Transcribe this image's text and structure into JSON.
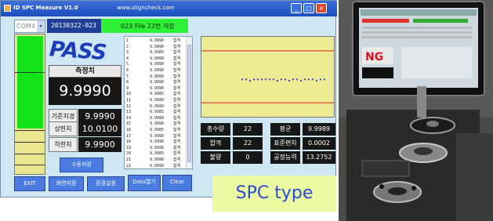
{
  "window": {
    "title": "ID SPC Measure V1.0",
    "url": "www.aligncheck.com",
    "minimize_glyph": "_",
    "maximize_glyph": "□",
    "close_glyph": "×"
  },
  "port": {
    "selected": "COM4",
    "arrow": "▾"
  },
  "date_code": "20130322-023",
  "file_status": "023 File 22번 저장",
  "result": "PASS",
  "measured": {
    "label": "측정치",
    "value": "9.9990"
  },
  "limits": [
    {
      "label": "기준치경",
      "value": "9.9990"
    },
    {
      "label": "상한치",
      "value": "10.0100"
    },
    {
      "label": "하한치",
      "value": "9.9900"
    }
  ],
  "buttons": {
    "manual_save": "수동저장",
    "exit": "EXIT",
    "screen_save": "화면저장",
    "settings": "환경설정",
    "data_open": "Data열기",
    "clear": "Clear"
  },
  "measurement_list": [
    {
      "n": "1",
      "v": "9.9990",
      "r": "합격"
    },
    {
      "n": "2",
      "v": "9.9990",
      "r": "합격"
    },
    {
      "n": "3",
      "v": "9.9985",
      "r": "합격"
    },
    {
      "n": "4",
      "v": "9.9990",
      "r": "합격"
    },
    {
      "n": "5",
      "v": "9.9990",
      "r": "합격"
    },
    {
      "n": "6",
      "v": "9.9990",
      "r": "합격"
    },
    {
      "n": "7",
      "v": "9.9990",
      "r": "합격"
    },
    {
      "n": "8",
      "v": "9.9990",
      "r": "합격"
    },
    {
      "n": "9",
      "v": "9.9990",
      "r": "합격"
    },
    {
      "n": "10",
      "v": "9.9985",
      "r": "합격"
    },
    {
      "n": "11",
      "v": "9.9990",
      "r": "합격"
    },
    {
      "n": "12",
      "v": "9.9990",
      "r": "합격"
    },
    {
      "n": "13",
      "v": "9.9985",
      "r": "합격"
    },
    {
      "n": "14",
      "v": "9.9990",
      "r": "합격"
    },
    {
      "n": "15",
      "v": "9.9990",
      "r": "합격"
    },
    {
      "n": "16",
      "v": "9.9985",
      "r": "합격"
    },
    {
      "n": "17",
      "v": "9.9990",
      "r": "합격"
    },
    {
      "n": "18",
      "v": "9.9990",
      "r": "합격"
    },
    {
      "n": "19",
      "v": "9.9990",
      "r": "합격"
    },
    {
      "n": "20",
      "v": "9.9985",
      "r": "합격"
    },
    {
      "n": "21",
      "v": "9.9990",
      "r": "합격"
    },
    {
      "n": "22",
      "v": "9.9990",
      "r": "합격"
    }
  ],
  "stats": {
    "total_label": "총수량",
    "total": "22",
    "pass_label": "합격",
    "pass": "22",
    "fail_label": "불량",
    "fail": "0",
    "mean_label": "평균",
    "mean": "9.9989",
    "std_label": "표준편차",
    "std": "0.0002",
    "cpk_label": "공정능력",
    "cpk": "13.2752"
  },
  "caption": "SPC type",
  "colors": {
    "pass_indicator": "#13e319",
    "limit_line": "#d62020",
    "data_point": "#2535c8"
  }
}
